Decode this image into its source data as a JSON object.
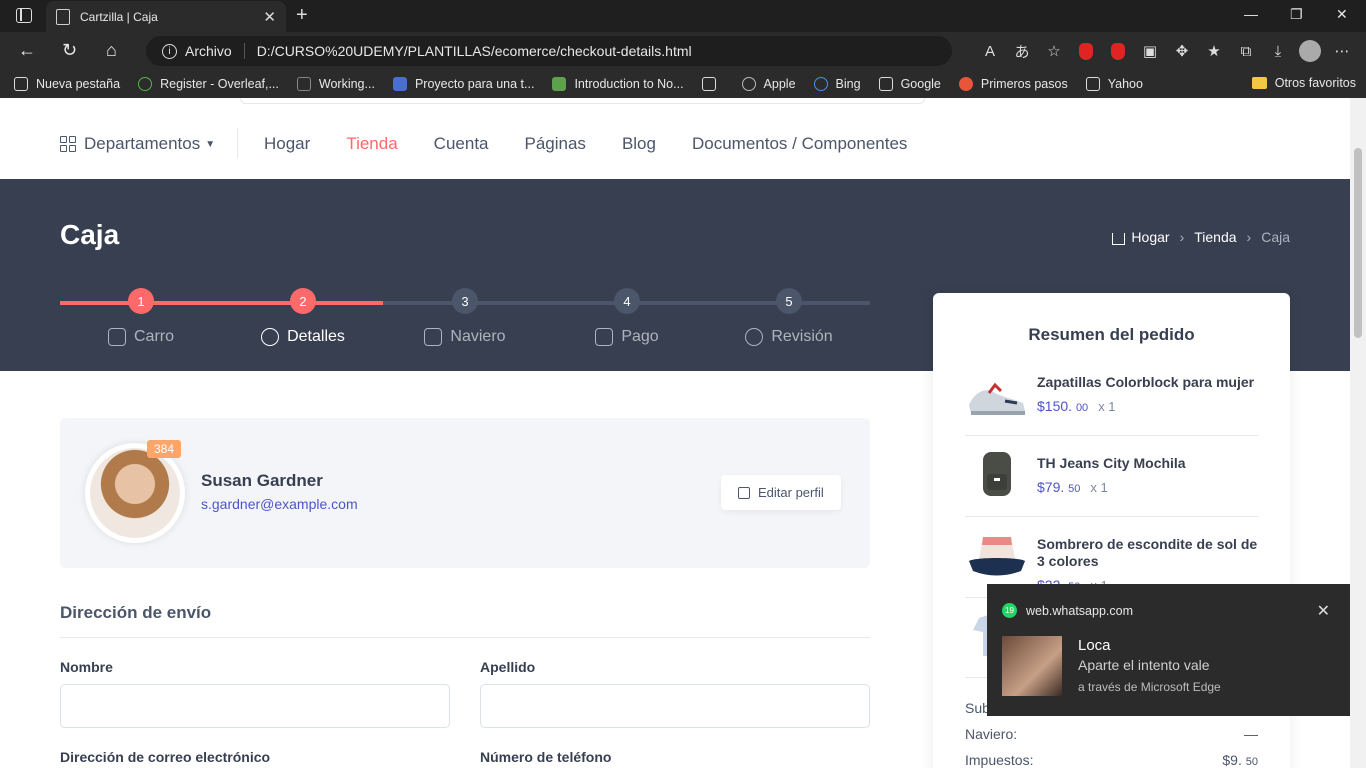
{
  "browser": {
    "tab_title": "Cartzilla | Caja",
    "address_label": "Archivo",
    "url": "D:/CURSO%20UDEMY/PLANTILLAS/ecomerce/checkout-details.html",
    "bookmarks": [
      "Nueva pestaña",
      "Register - Overleaf,...",
      "Working...",
      "Proyecto para una t...",
      "Introduction to No...",
      "",
      "Apple",
      "Bing",
      "Google",
      "Primeros pasos",
      "Yahoo"
    ],
    "other_favorites": "Otros favoritos"
  },
  "nav": {
    "departments": "Departamentos",
    "items": [
      "Hogar",
      "Tienda",
      "Cuenta",
      "Páginas",
      "Blog",
      "Documentos / Componentes"
    ],
    "active": "Tienda"
  },
  "hero": {
    "title": "Caja",
    "breadcrumb": [
      "Hogar",
      "Tienda",
      "Caja"
    ]
  },
  "steps": [
    {
      "num": "1",
      "label": "Carro",
      "state": "done"
    },
    {
      "num": "2",
      "label": "Detalles",
      "state": "current"
    },
    {
      "num": "3",
      "label": "Naviero",
      "state": "todo"
    },
    {
      "num": "4",
      "label": "Pago",
      "state": "todo"
    },
    {
      "num": "5",
      "label": "Revisión",
      "state": "todo"
    }
  ],
  "profile": {
    "badge": "384",
    "name": "Susan Gardner",
    "email": "s.gardner@example.com",
    "edit_label": "Editar perfil"
  },
  "shipping": {
    "title": "Dirección de envío",
    "first_name_label": "Nombre",
    "last_name_label": "Apellido",
    "email_label": "Dirección de correo electrónico",
    "phone_label": "Número de teléfono"
  },
  "summary": {
    "title": "Resumen del pedido",
    "items": [
      {
        "name": "Zapatillas Colorblock para mujer",
        "price_main": "$150.",
        "price_cents": "00",
        "qty": "x 1"
      },
      {
        "name": "TH Jeans City Mochila",
        "price_main": "$79.",
        "price_cents": "50",
        "qty": "x 1"
      },
      {
        "name": "Sombrero de escondite de sol de 3 colores",
        "price_main": "$22.",
        "price_cents": "50",
        "qty": "x 1"
      }
    ],
    "subtotal_label": "Sub",
    "shipping_label": "Naviero:",
    "shipping_value": "—",
    "tax_label": "Impuestos:",
    "tax_main": "$9.",
    "tax_cents": "50"
  },
  "notification": {
    "source": "web.whatsapp.com",
    "badge": "19",
    "sender": "Loca",
    "message": "Aparte el intento vale",
    "via": "a través de Microsoft Edge"
  },
  "colors": {
    "accent": "#fe696a",
    "hero_bg": "#373f50",
    "link": "#4e54c8",
    "badge": "#fea569"
  }
}
